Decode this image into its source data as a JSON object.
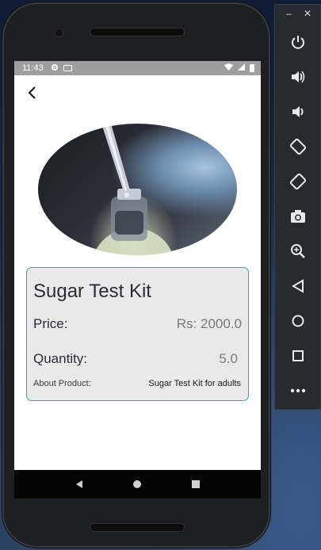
{
  "status_bar": {
    "time": "11:43"
  },
  "product": {
    "name": "Sugar Test Kit",
    "price_label": "Price:",
    "price_value": "Rs: 2000.0",
    "quantity_label": "Quantity:",
    "quantity_value": "5.0",
    "about_label": "About Product:",
    "about_value": "Sugar Test Kit for adults"
  },
  "emulator_toolbar": {
    "minimize_label": "–",
    "close_label": "✕",
    "buttons": [
      "power-icon",
      "volume-up-icon",
      "volume-down-icon",
      "rotate-left-icon",
      "rotate-right-icon",
      "camera-icon",
      "zoom-icon",
      "back-icon",
      "home-icon",
      "overview-icon",
      "more-icon"
    ]
  },
  "colors": {
    "card_border": "#20b59e",
    "card_background": "#e9e9e9",
    "status_bar": "#9e9e9e",
    "nav_bar": "#050505"
  }
}
